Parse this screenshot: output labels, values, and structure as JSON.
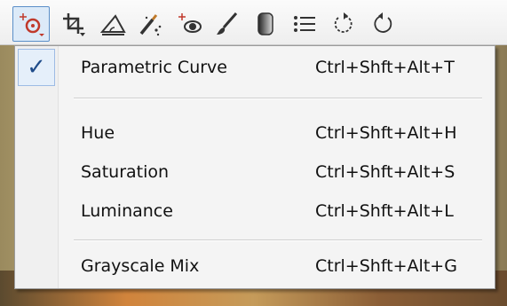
{
  "toolbar": {
    "icons": [
      "radial-filter-icon",
      "crop-icon",
      "straighten-icon",
      "spot-heal-icon",
      "red-eye-icon",
      "brush-icon",
      "gradient-icon",
      "list-icon",
      "rotate-left-icon",
      "rotate-right-icon"
    ]
  },
  "menu": {
    "items": [
      {
        "label": "Parametric Curve",
        "shortcut": "Ctrl+Shft+Alt+T",
        "checked": true
      },
      {
        "label": "Hue",
        "shortcut": "Ctrl+Shft+Alt+H",
        "checked": false
      },
      {
        "label": "Saturation",
        "shortcut": "Ctrl+Shft+Alt+S",
        "checked": false
      },
      {
        "label": "Luminance",
        "shortcut": "Ctrl+Shft+Alt+L",
        "checked": false
      },
      {
        "label": "Grayscale Mix",
        "shortcut": "Ctrl+Shft+Alt+G",
        "checked": false
      }
    ],
    "check_glyph": "✓"
  },
  "colors": {
    "accent": "#5b8fc8",
    "check": "#1f4c8a",
    "menu_bg": "#f4f4f4"
  }
}
